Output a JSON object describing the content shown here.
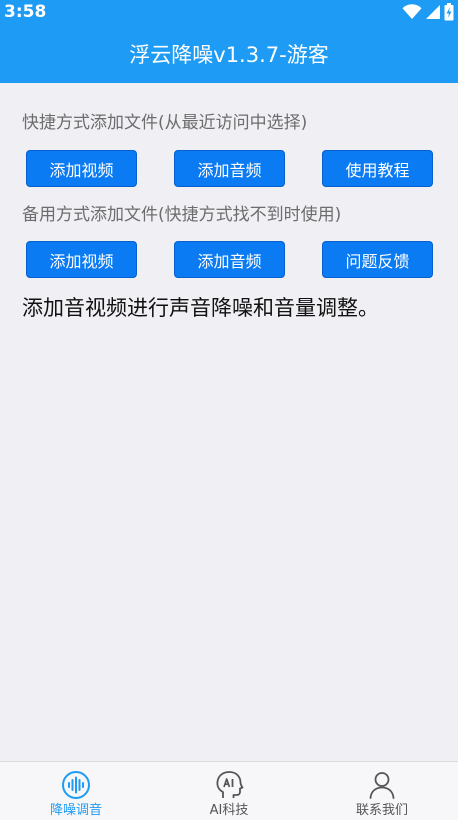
{
  "status_bar": {
    "time": "3:58"
  },
  "app_bar": {
    "title": "浮云降噪v1.3.7-游客"
  },
  "shortcut_section": {
    "label": "快捷方式添加文件(从最近访问中选择)",
    "buttons": [
      {
        "label": "添加视频"
      },
      {
        "label": "添加音频"
      },
      {
        "label": "使用教程"
      }
    ]
  },
  "backup_section": {
    "label": "备用方式添加文件(快捷方式找不到时使用)",
    "buttons": [
      {
        "label": "添加视频"
      },
      {
        "label": "添加音频"
      },
      {
        "label": "问题反馈"
      }
    ]
  },
  "description": "添加音视频进行声音降噪和音量调整。",
  "tab_bar": {
    "active_index": 0,
    "tabs": [
      {
        "label": "降噪调音",
        "icon": "sound-wave-icon"
      },
      {
        "label": "AI科技",
        "icon": "ai-head-icon"
      },
      {
        "label": "联系我们",
        "icon": "person-icon"
      }
    ]
  },
  "colors": {
    "primary": "#1e9bf5",
    "button": "#0a7bf2",
    "background": "#efeff4"
  }
}
